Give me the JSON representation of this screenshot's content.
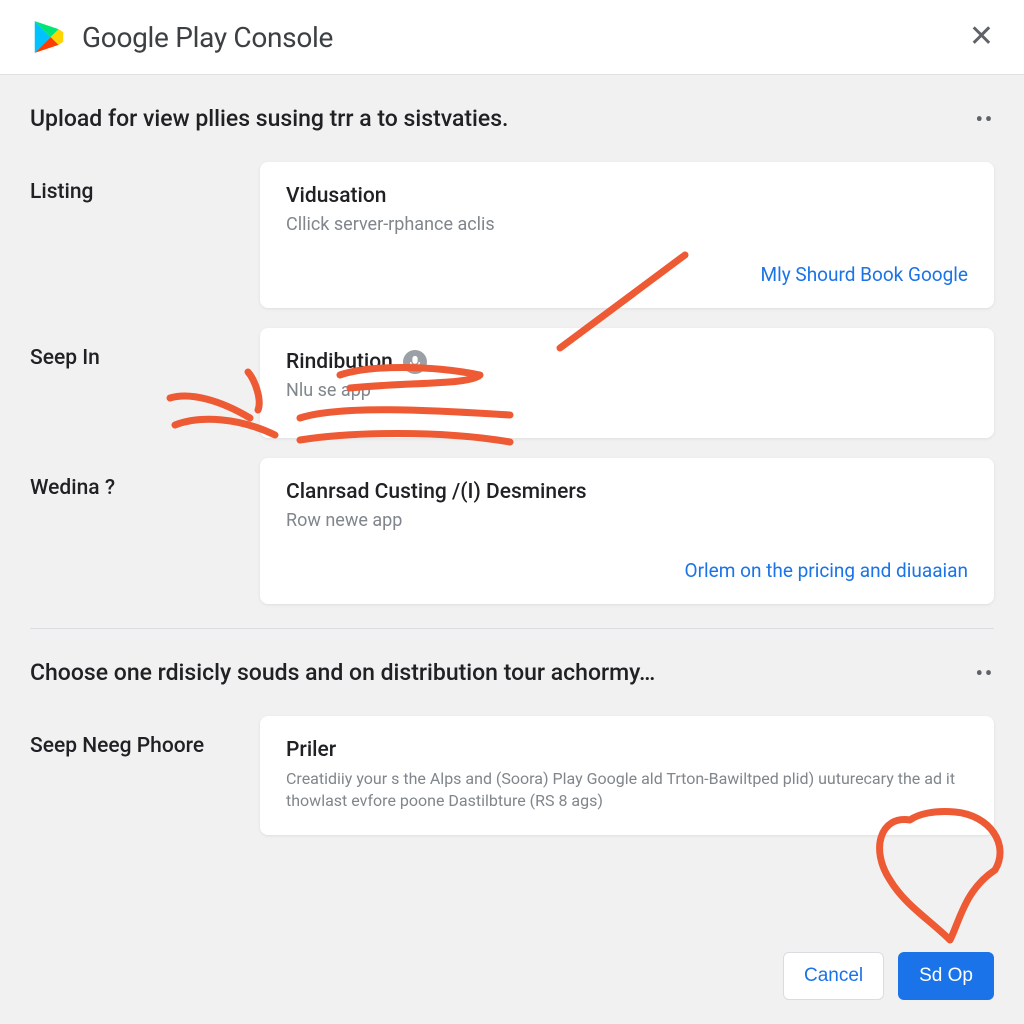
{
  "header": {
    "title": "Google Play Console"
  },
  "section1": {
    "title": "Upload for view pllies susing trr a to sistvaties.",
    "rows": [
      {
        "label": "Listing",
        "card": {
          "title": "Vidusation",
          "sub": "Cllick server-rphance aclis",
          "link": "Mly Shourd Book Google"
        }
      },
      {
        "label": "Seep In",
        "card": {
          "title": "Rindibution",
          "sub": "Nlu se app"
        }
      },
      {
        "label": "Wedina ?",
        "card": {
          "title": "Clanrsad Custing /(I) Desminers",
          "sub": "Row newe app",
          "link": "Orlem on the pricing and diuaaian"
        }
      }
    ]
  },
  "section2": {
    "title": "Choose one rdisicly souds and on distribution tour achormy…",
    "rows": [
      {
        "label": "Seep Neeg Phoore",
        "card": {
          "title": "Priler",
          "sub": "Creatidiiy your s the Alps and (Soora) Play Google ald Trton-Bawiltped plid) uuturecary the ad it thowlast evfore poone Dastilbture (RS 8 ags)"
        }
      }
    ]
  },
  "footer": {
    "cancel": "Cancel",
    "submit": "Sd Op"
  }
}
